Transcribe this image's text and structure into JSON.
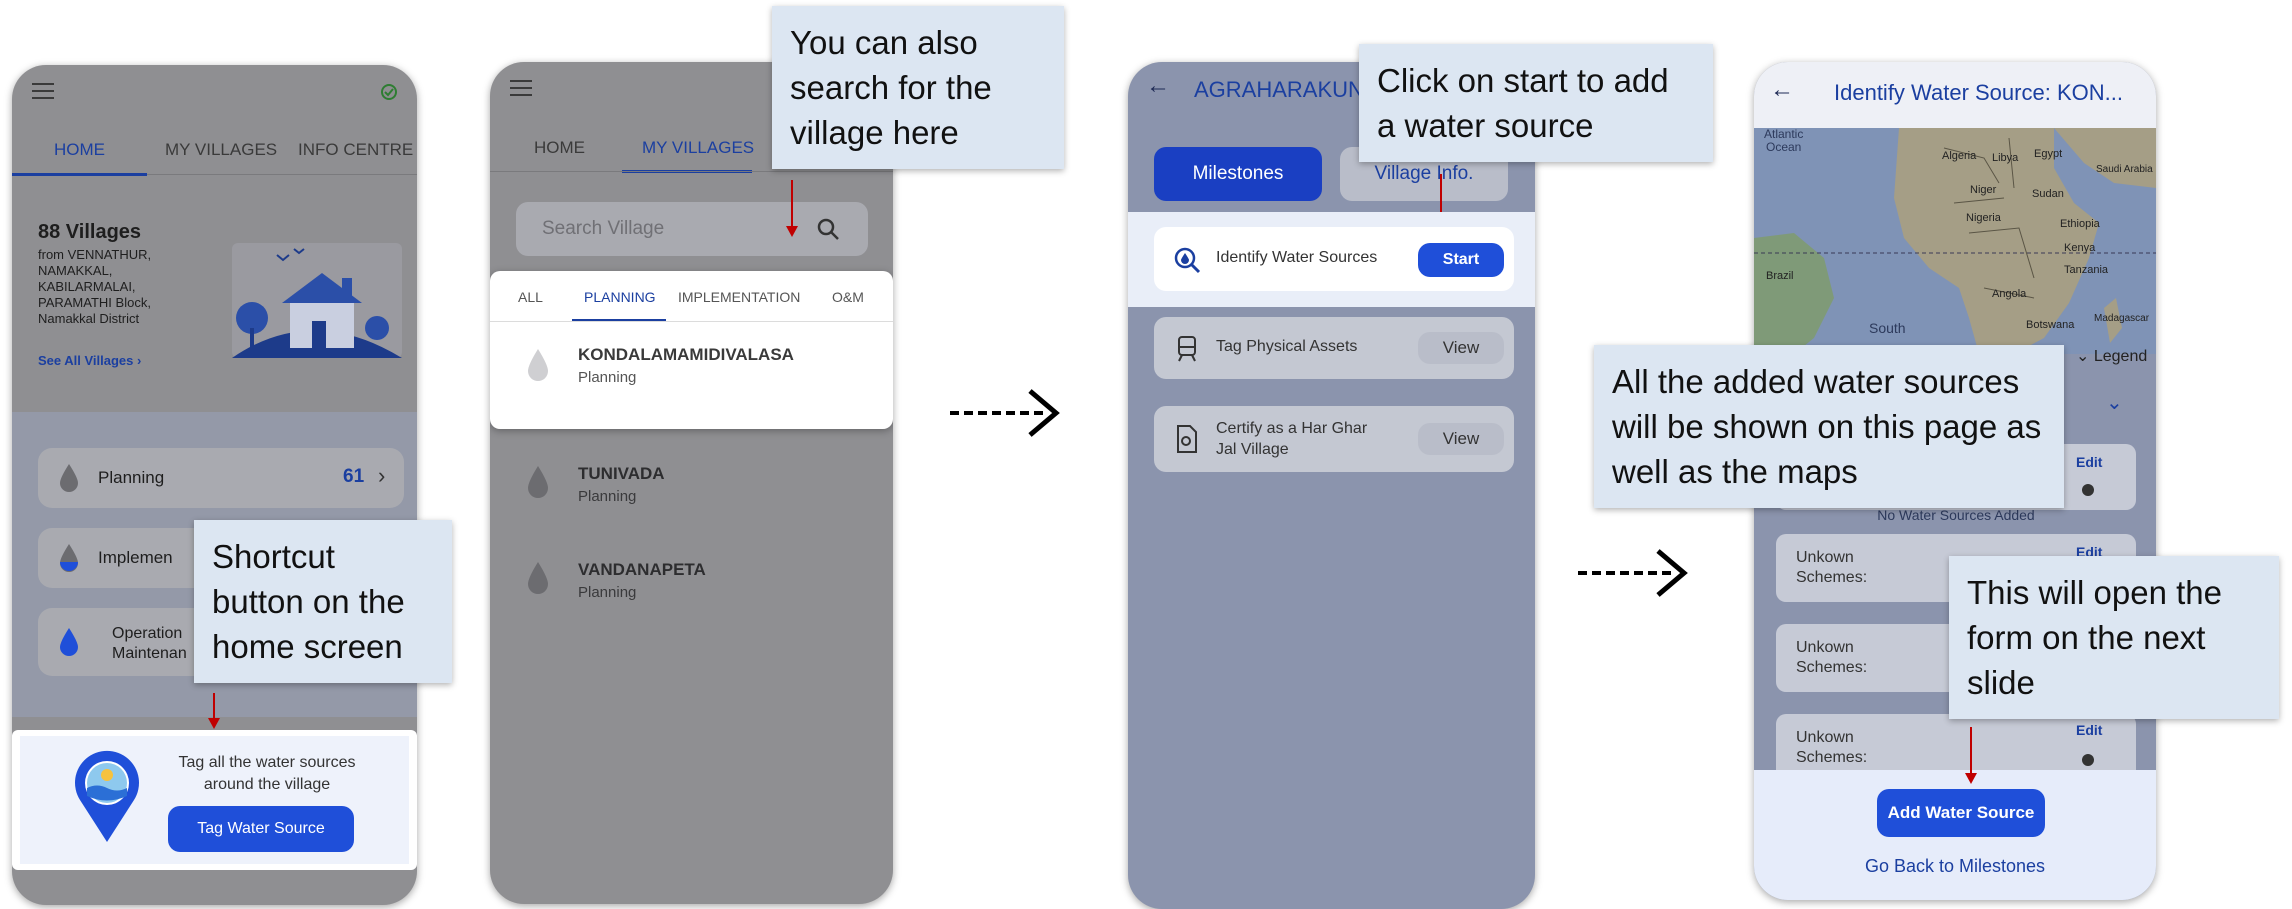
{
  "screen1": {
    "tabs": [
      "HOME",
      "MY VILLAGES",
      "INFO CENTRE"
    ],
    "villages_count": "88 Villages",
    "villages_from": [
      "from VENNATHUR,",
      "NAMAKKAL,",
      "KABILARMALAI,",
      "PARAMATHI Block,",
      "Namakkal District"
    ],
    "see_all": "See All Villages",
    "planning_label": "Planning",
    "planning_count": "61",
    "implementation_label": "Implemen",
    "om_label_1": "Operation",
    "om_label_2": "Maintenan",
    "tag_text_1": "Tag all the water sources",
    "tag_text_2": "around the village",
    "tag_button": "Tag Water Source"
  },
  "screen2": {
    "tabs": [
      "HOME",
      "MY VILLAGES"
    ],
    "search_placeholder": "Search Village",
    "filter_tabs": [
      "ALL",
      "PLANNING",
      "IMPLEMENTATION",
      "O&M"
    ],
    "villages": [
      {
        "name": "KONDALAMAMIDIVALASA",
        "status": "Planning"
      },
      {
        "name": "TUNIVADA",
        "status": "Planning"
      },
      {
        "name": "VANDANAPETA",
        "status": "Planning"
      }
    ]
  },
  "screen3": {
    "title": "AGRAHARAKUN",
    "milestones_button": "Milestones",
    "village_info_button": "Village Info.",
    "items": [
      {
        "label": "Identify Water Sources",
        "action": "Start"
      },
      {
        "label": "Tag Physical Assets",
        "action": "View"
      },
      {
        "label_1": "Certify as a Har Ghar",
        "label_2": "Jal Village",
        "action": "View"
      }
    ]
  },
  "screen4": {
    "title": "Identify Water Source: KON...",
    "map_labels": [
      "Atlantic",
      "Ocean",
      "Algeria",
      "Libya",
      "Egypt",
      "Saudi Arabia",
      "Niger",
      "Sudan",
      "Nigeria",
      "Ethiopia",
      "Kenya",
      "Tanzania",
      "Angola",
      "Brazil",
      "South",
      "Botswana",
      "Madagascar"
    ],
    "legend": "Legend",
    "edit_label": "Edit",
    "no_sources": "No Water Sources Added",
    "source_rows": [
      {
        "line1": "Unkown",
        "line2": "Schemes:"
      },
      {
        "line1": "Unkown",
        "line2": "Schemes:"
      },
      {
        "line1": "Unkown",
        "line2": "Schemes:"
      }
    ],
    "add_button": "Add Water Source",
    "back_link": "Go Back to Milestones"
  },
  "notes": {
    "shortcut": "Shortcut button on the home screen",
    "search": "You can also search for the village here",
    "start": "Click on start to add a water source",
    "added": "All the added water sources will be shown on this page as well as the maps",
    "open_form": "This will open the form on the next slide"
  },
  "colors": {
    "primary": "#1f4fd9",
    "note_bg": "#dce6f2",
    "arrow_red": "#c00000"
  }
}
